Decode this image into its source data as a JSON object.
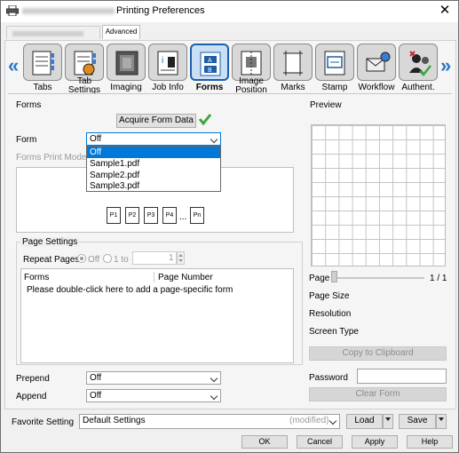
{
  "window": {
    "title": "Printing Preferences",
    "close_glyph": "✕"
  },
  "tabs": {
    "advanced": "Advanced"
  },
  "toolbar": [
    {
      "label": "Tabs",
      "icon": "tabs-icon"
    },
    {
      "label": "Tab Settings",
      "icon": "tab-settings-icon"
    },
    {
      "label": "Imaging",
      "icon": "imaging-icon"
    },
    {
      "label": "Job Info",
      "icon": "job-info-icon"
    },
    {
      "label": "Forms",
      "icon": "forms-icon",
      "active": true
    },
    {
      "label": "Image Position",
      "icon": "image-position-icon"
    },
    {
      "label": "Marks",
      "icon": "marks-icon"
    },
    {
      "label": "Stamp",
      "icon": "stamp-icon"
    },
    {
      "label": "Workflow",
      "icon": "workflow-icon"
    },
    {
      "label": "Authent.",
      "icon": "authentication-icon"
    }
  ],
  "toolbar_labels": {
    "tabs": "Tabs",
    "tab_settings_1": "Tab",
    "tab_settings_2": "Settings",
    "imaging": "Imaging",
    "job_info": "Job Info",
    "forms": "Forms",
    "image_pos_1": "Image",
    "image_pos_2": "Position",
    "marks": "Marks",
    "stamp": "Stamp",
    "workflow": "Workflow",
    "authent": "Authent."
  },
  "forms": {
    "section_title": "Forms",
    "acquire_button": "Acquire Form Data",
    "form_label": "Form",
    "form_value": "Off",
    "form_options": [
      "Off",
      "Sample1.pdf",
      "Sample2.pdf",
      "Sample3.pdf"
    ],
    "print_mode_label": "Forms Print Mode",
    "pages": [
      "P1",
      "P2",
      "P3",
      "P4",
      "Pn"
    ],
    "ellipsis": "..."
  },
  "page_settings": {
    "title": "Page Settings",
    "repeat_label": "Repeat Pages",
    "off_label": "Off",
    "range_label": "1 to",
    "range_value": "1",
    "col_forms": "Forms",
    "col_page_number": "Page Number",
    "hint": "Please double-click here to add a page-specific form"
  },
  "prepend": {
    "label": "Prepend",
    "value": "Off"
  },
  "append": {
    "label": "Append",
    "value": "Off"
  },
  "preview": {
    "title": "Preview",
    "page_label": "Page",
    "page_count": "1 / 1",
    "page_size_label": "Page Size",
    "resolution_label": "Resolution",
    "screen_type_label": "Screen Type",
    "copy_button": "Copy to Clipboard",
    "password_label": "Password",
    "password_value": "",
    "clear_button": "Clear Form"
  },
  "favorite": {
    "label": "Favorite Setting",
    "value": "Default Settings",
    "modified": "(modified)",
    "load": "Load",
    "save": "Save"
  },
  "dialog_buttons": {
    "ok": "OK",
    "cancel": "Cancel",
    "apply": "Apply",
    "help": "Help"
  },
  "colors": {
    "accent": "#0078d7",
    "check": "#3da83a",
    "active_border": "#1e5ea8"
  }
}
